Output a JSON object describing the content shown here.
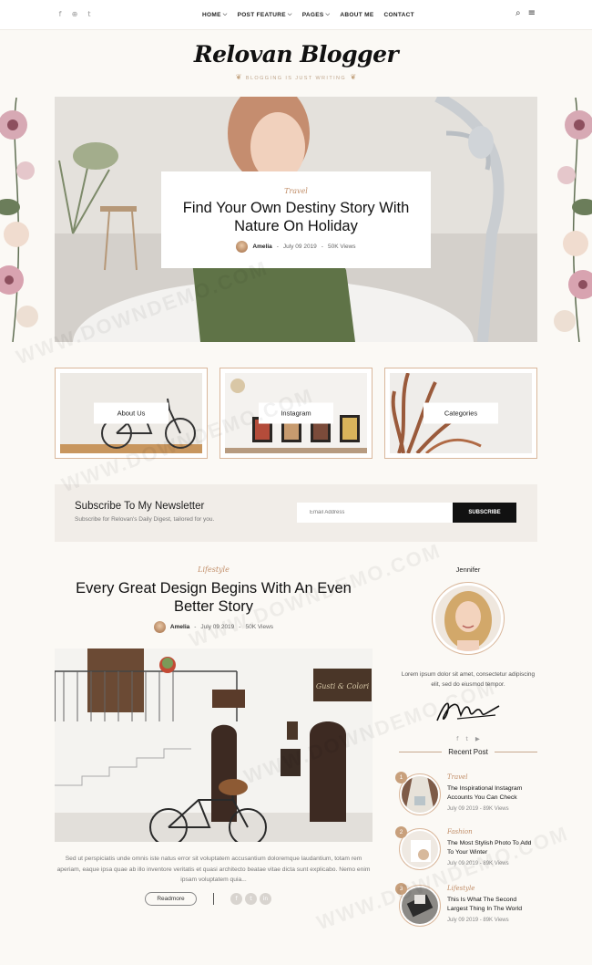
{
  "topbar": {
    "social_icons": [
      "facebook-icon",
      "pinterest-icon",
      "twitter-icon"
    ],
    "social_glyphs": [
      "f",
      "⊕",
      "t"
    ],
    "nav": [
      {
        "label": "HOME",
        "has_dropdown": true
      },
      {
        "label": "POST FEATURE",
        "has_dropdown": true
      },
      {
        "label": "PAGES",
        "has_dropdown": true
      },
      {
        "label": "ABOUT ME",
        "has_dropdown": false
      },
      {
        "label": "CONTACT",
        "has_dropdown": false
      }
    ],
    "search_icon": "search-icon",
    "menu_icon": "menu-icon"
  },
  "logo": {
    "title": "Relovan Blogger",
    "tagline": "BLOGGING IS JUST WRITING"
  },
  "hero": {
    "category": "Travel",
    "title": "Find Your Own Destiny Story With Nature On Holiday",
    "author": "Amelia",
    "date": "July 09 2019",
    "views": "50K Views"
  },
  "feature_boxes": [
    {
      "label": "About Us"
    },
    {
      "label": "Instagram"
    },
    {
      "label": "Categories"
    }
  ],
  "newsletter": {
    "title": "Subscribe To My Newsletter",
    "subtitle": "Subscribe for Relovan's Daily Digest, tailored for you.",
    "placeholder": "Email Address",
    "button": "SUBSCRIBE"
  },
  "post": {
    "category": "Lifestyle",
    "title": "Every Great Design Begins With An Even Better Story",
    "author": "Amelia",
    "date": "July 09 2019",
    "views": "50K Views",
    "sign_text": "Gusti & Colori",
    "excerpt": "Sed ut perspiciatis unde omnis iste natus error sit voluptatem accusantium doloremque laudantium, totam rem aperiam, eaque ipsa quae ab illo inventore veritatis et quasi architecto beatae vitae dicta sunt explicabo. Nemo enim ipsam voluptatem quia...",
    "readmore": "Readmore",
    "share_icons": [
      "facebook-icon",
      "twitter-icon",
      "linkedin-icon"
    ],
    "share_glyphs": [
      "f",
      "t",
      "in"
    ]
  },
  "sidebar": {
    "name": "Jennifer",
    "bio": "Lorem ipsum dolor sit amet, consectetur adipiscing elit, sed do eiusmod tempor.",
    "social_glyphs": [
      "f",
      "t",
      "▶"
    ],
    "recent_heading": "Recent Post",
    "recent_posts": [
      {
        "num": "1",
        "category": "Travel",
        "title": "The Inspirational Instagram Accounts You Can Check",
        "date": "July 09 2019",
        "views": "89K Views"
      },
      {
        "num": "2",
        "category": "Fashion",
        "title": "The Most Stylish Photo To Add To Your Winter",
        "date": "July 09 2019",
        "views": "89K Views"
      },
      {
        "num": "3",
        "category": "Lifestyle",
        "title": "This Is What The Second Largest Thing In The World",
        "date": "July 09 2019",
        "views": "89K Views"
      }
    ]
  },
  "watermark": "WWW.DOWNDEMO.COM",
  "colors": {
    "accent": "#c08c66",
    "border": "#d9b79b",
    "background": "#fbf9f5",
    "button": "#111111"
  }
}
